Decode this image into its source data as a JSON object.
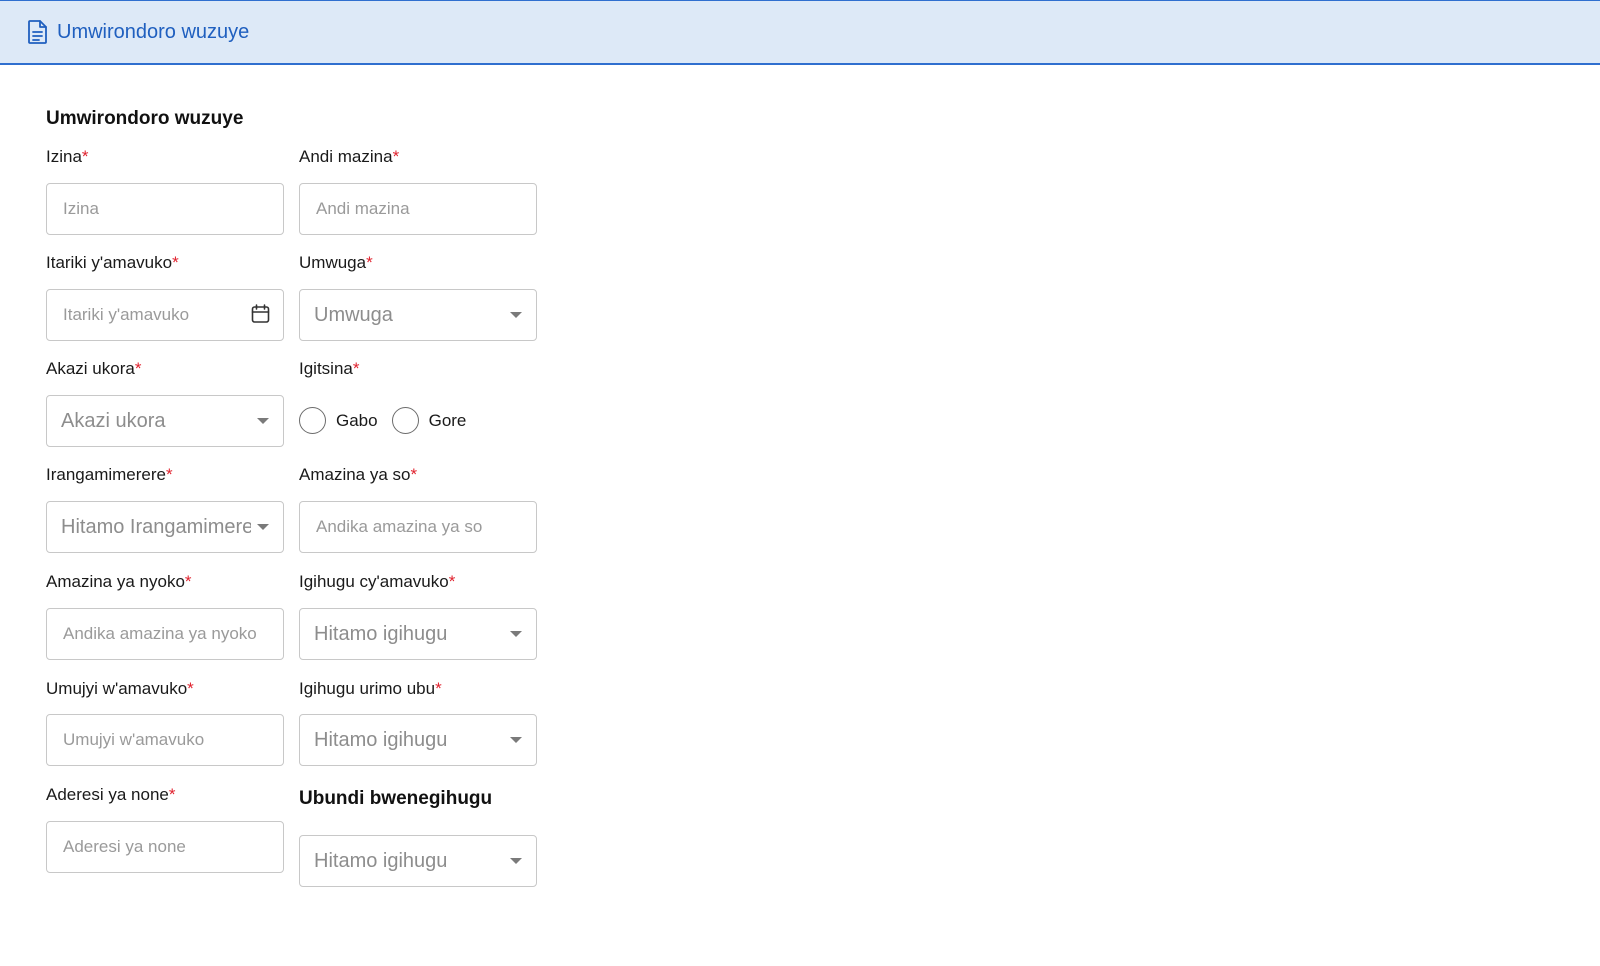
{
  "header": {
    "title": "Umwirondoro wuzuye",
    "icon": "document-icon"
  },
  "form": {
    "section_title": "Umwirondoro wuzuye",
    "required_marker": "*",
    "fields": {
      "first_name": {
        "label": "Izina",
        "placeholder": "Izina"
      },
      "other_names": {
        "label": "Andi mazina",
        "placeholder": "Andi mazina"
      },
      "birth_date": {
        "label": "Itariki y'amavuko",
        "placeholder": "Itariki y'amavuko"
      },
      "origin": {
        "label": "Umwuga",
        "selected": "Umwuga"
      },
      "occupation": {
        "label": "Akazi ukora",
        "selected": "Akazi ukora"
      },
      "gender": {
        "label": "Igitsina",
        "options": [
          "Gabo",
          "Gore"
        ]
      },
      "marital_status": {
        "label": "Irangamimerere",
        "selected": "Hitamo Irangamimerere"
      },
      "father_name": {
        "label": "Amazina ya so",
        "placeholder": "Andika amazina ya so"
      },
      "mother_name": {
        "label": "Amazina ya nyoko",
        "placeholder": "Andika amazina ya nyoko"
      },
      "birth_country": {
        "label": "Igihugu cy'amavuko",
        "selected": "Hitamo igihugu"
      },
      "birth_city": {
        "label": "Umujyi w'amavuko",
        "placeholder": "Umujyi w'amavuko"
      },
      "residence_country": {
        "label": "Igihugu urimo ubu",
        "selected": "Hitamo igihugu"
      },
      "current_address": {
        "label": "Aderesi ya none",
        "placeholder": "Aderesi ya none"
      }
    },
    "dual_nationality": {
      "title": "Ubundi bwenegihugu",
      "selected": "Hitamo igihugu"
    }
  }
}
